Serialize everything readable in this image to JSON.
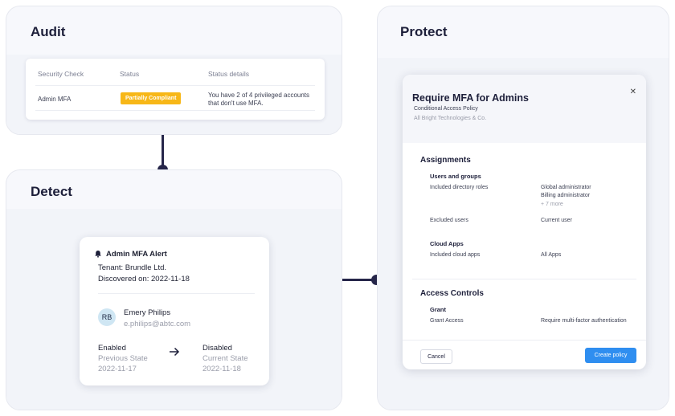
{
  "audit": {
    "title": "Audit",
    "headers": [
      "Security Check",
      "Status",
      "Status details"
    ],
    "row": {
      "check": "Admin MFA",
      "status": "Partially Compliant",
      "details": "You have 2 of 4 privileged accounts that don't use MFA."
    },
    "status_color": "#f7b718"
  },
  "detect": {
    "title": "Detect",
    "alert": {
      "title": "Admin MFA Alert",
      "tenant": "Tenant: Brundle Ltd.",
      "discovered": "Discovered on: 2022-11-18",
      "user_initials": "RB",
      "user_name": "Emery Philips",
      "user_email": "e.philips@abtc.com",
      "previous": {
        "value": "Enabled",
        "label": "Previous State",
        "date": "2022-11-17"
      },
      "current": {
        "value": "Disabled",
        "label": "Current State",
        "date": "2022-11-18"
      }
    }
  },
  "protect": {
    "title": "Protect",
    "modal": {
      "title": "Require MFA for Admins",
      "subtitle": "Conditional Access Policy",
      "org": "All Bright Technologies & Co.",
      "assignments": {
        "heading": "Assignments",
        "users_groups": "Users and groups",
        "included_roles_label": "Included directory roles",
        "included_roles": [
          "Global administrator",
          "Billing administrator",
          "+ 7 more"
        ],
        "excluded_label": "Excluded users",
        "excluded_value": "Current user",
        "cloud_apps": "Cloud Apps",
        "included_apps_label": "Included cloud apps",
        "included_apps_value": "All Apps"
      },
      "access": {
        "heading": "Access Controls",
        "grant": "Grant",
        "grant_label": "Grant Access",
        "grant_value": "Require multi-factor authentication"
      },
      "cancel": "Cancel",
      "create": "Create policy"
    },
    "button_color": "#2f8ef0"
  }
}
